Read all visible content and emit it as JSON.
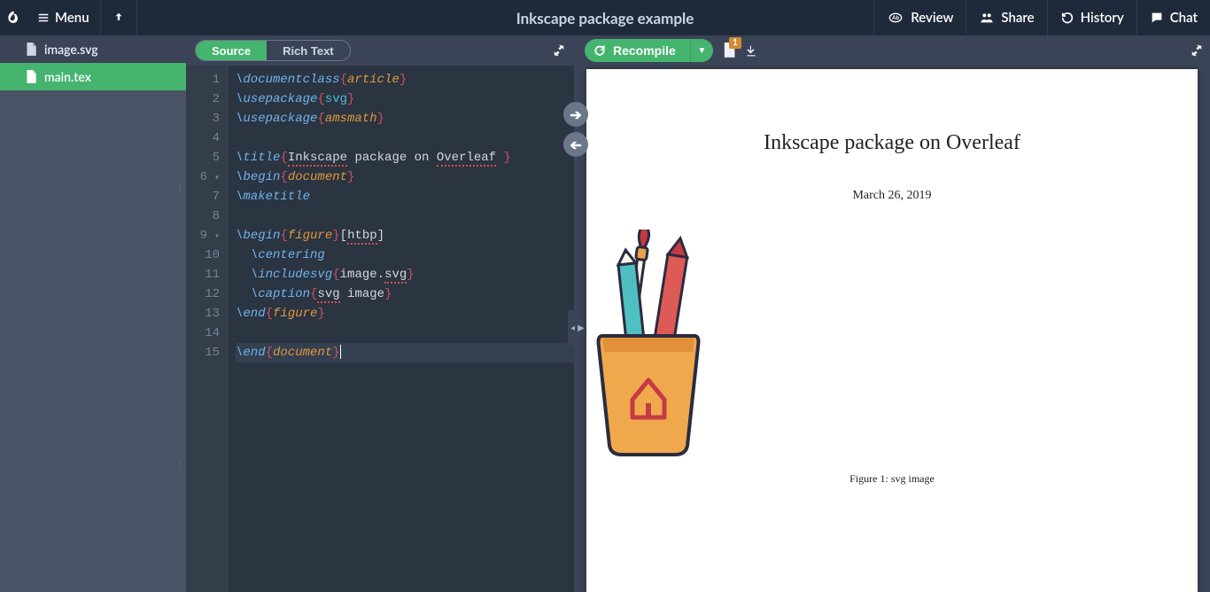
{
  "topbar": {
    "menu_label": "Menu",
    "project_title": "Inkscape package example",
    "actions": {
      "review": "Review",
      "share": "Share",
      "history": "History",
      "chat": "Chat"
    }
  },
  "file_panel": {
    "files": [
      {
        "name": "image.svg",
        "active": false
      },
      {
        "name": "main.tex",
        "active": true
      }
    ]
  },
  "editor": {
    "tabs": {
      "source": "Source",
      "rich_text": "Rich Text"
    },
    "lines": [
      {
        "n": 1,
        "tokens": [
          [
            "cmd",
            "\\documentclass"
          ],
          [
            "brace",
            "{"
          ],
          [
            "arg",
            "article"
          ],
          [
            "brace",
            "}"
          ]
        ]
      },
      {
        "n": 2,
        "tokens": [
          [
            "cmd",
            "\\usepackage"
          ],
          [
            "brace",
            "{"
          ],
          [
            "argblue",
            "svg"
          ],
          [
            "brace",
            "}"
          ]
        ]
      },
      {
        "n": 3,
        "tokens": [
          [
            "cmd",
            "\\usepackage"
          ],
          [
            "brace",
            "{"
          ],
          [
            "arg",
            "amsmath"
          ],
          [
            "brace",
            "}"
          ]
        ]
      },
      {
        "n": 4,
        "tokens": []
      },
      {
        "n": 5,
        "tokens": [
          [
            "cmd",
            "\\title"
          ],
          [
            "brace",
            "{"
          ],
          [
            "textspell",
            "Inkscape"
          ],
          [
            "text",
            " package on "
          ],
          [
            "textspell",
            "Overleaf"
          ],
          [
            "text",
            " "
          ],
          [
            "brace",
            "}"
          ]
        ]
      },
      {
        "n": 6,
        "fold": true,
        "tokens": [
          [
            "cmd",
            "\\begin"
          ],
          [
            "brace",
            "{"
          ],
          [
            "arg",
            "document"
          ],
          [
            "brace",
            "}"
          ]
        ]
      },
      {
        "n": 7,
        "tokens": [
          [
            "cmd",
            "\\maketitle"
          ]
        ]
      },
      {
        "n": 8,
        "tokens": []
      },
      {
        "n": 9,
        "fold": true,
        "tokens": [
          [
            "cmd",
            "\\begin"
          ],
          [
            "brace",
            "{"
          ],
          [
            "arg",
            "figure"
          ],
          [
            "brace",
            "}"
          ],
          [
            "opt",
            "["
          ],
          [
            "textspell",
            "htbp"
          ],
          [
            "opt",
            "]"
          ]
        ]
      },
      {
        "n": 10,
        "tokens": [
          [
            "text",
            "  "
          ],
          [
            "cmd",
            "\\centering"
          ]
        ]
      },
      {
        "n": 11,
        "tokens": [
          [
            "text",
            "  "
          ],
          [
            "cmd",
            "\\includesvg"
          ],
          [
            "brace",
            "{"
          ],
          [
            "text",
            "image."
          ],
          [
            "textspell",
            "svg"
          ],
          [
            "brace",
            "}"
          ]
        ]
      },
      {
        "n": 12,
        "tokens": [
          [
            "text",
            "  "
          ],
          [
            "cmd",
            "\\caption"
          ],
          [
            "brace",
            "{"
          ],
          [
            "textspell",
            "svg"
          ],
          [
            "text",
            " image"
          ],
          [
            "brace",
            "}"
          ]
        ]
      },
      {
        "n": 13,
        "tokens": [
          [
            "cmd",
            "\\end"
          ],
          [
            "brace",
            "{"
          ],
          [
            "arg",
            "figure"
          ],
          [
            "brace",
            "}"
          ]
        ]
      },
      {
        "n": 14,
        "tokens": []
      },
      {
        "n": 15,
        "hl": true,
        "cursor": true,
        "tokens": [
          [
            "cmd",
            "\\end"
          ],
          [
            "brace",
            "{"
          ],
          [
            "arg",
            "document"
          ],
          [
            "brace",
            "}"
          ]
        ]
      }
    ]
  },
  "pdf": {
    "recompile_label": "Recompile",
    "log_badge": "1",
    "page": {
      "title": "Inkscape package on Overleaf",
      "date": "March 26, 2019",
      "caption": "Figure 1: svg image"
    }
  }
}
